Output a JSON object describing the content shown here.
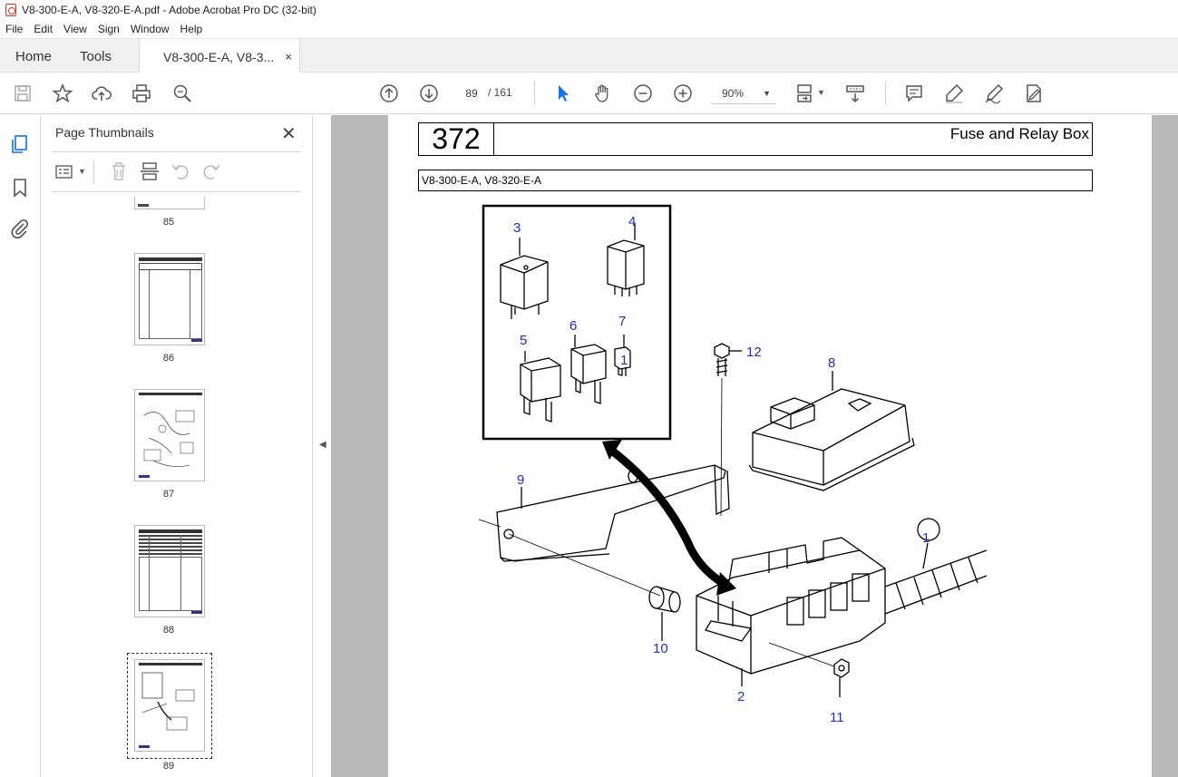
{
  "window": {
    "title": "V8-300-E-A, V8-320-E-A.pdf - Adobe Acrobat Pro DC (32-bit)"
  },
  "menu": [
    "File",
    "Edit",
    "View",
    "Sign",
    "Window",
    "Help"
  ],
  "tabs": {
    "home": "Home",
    "tools": "Tools",
    "document": "V8-300-E-A, V8-3...",
    "close": "×"
  },
  "toolbar": {
    "current_page": "89",
    "page_sep": "/ 161",
    "zoom": "90%"
  },
  "panel": {
    "title": "Page Thumbnails",
    "thumbnails": [
      {
        "label": "85"
      },
      {
        "label": "86"
      },
      {
        "label": "87"
      },
      {
        "label": "88"
      },
      {
        "label": "89"
      }
    ]
  },
  "document": {
    "page_number": "372",
    "title": "Fuse and Relay Box",
    "model": "V8-300-E-A, V8-320-E-A",
    "callouts": [
      "3",
      "4",
      "5",
      "6",
      "7",
      "1",
      "12",
      "8",
      "9",
      "1",
      "10",
      "2",
      "11"
    ]
  }
}
